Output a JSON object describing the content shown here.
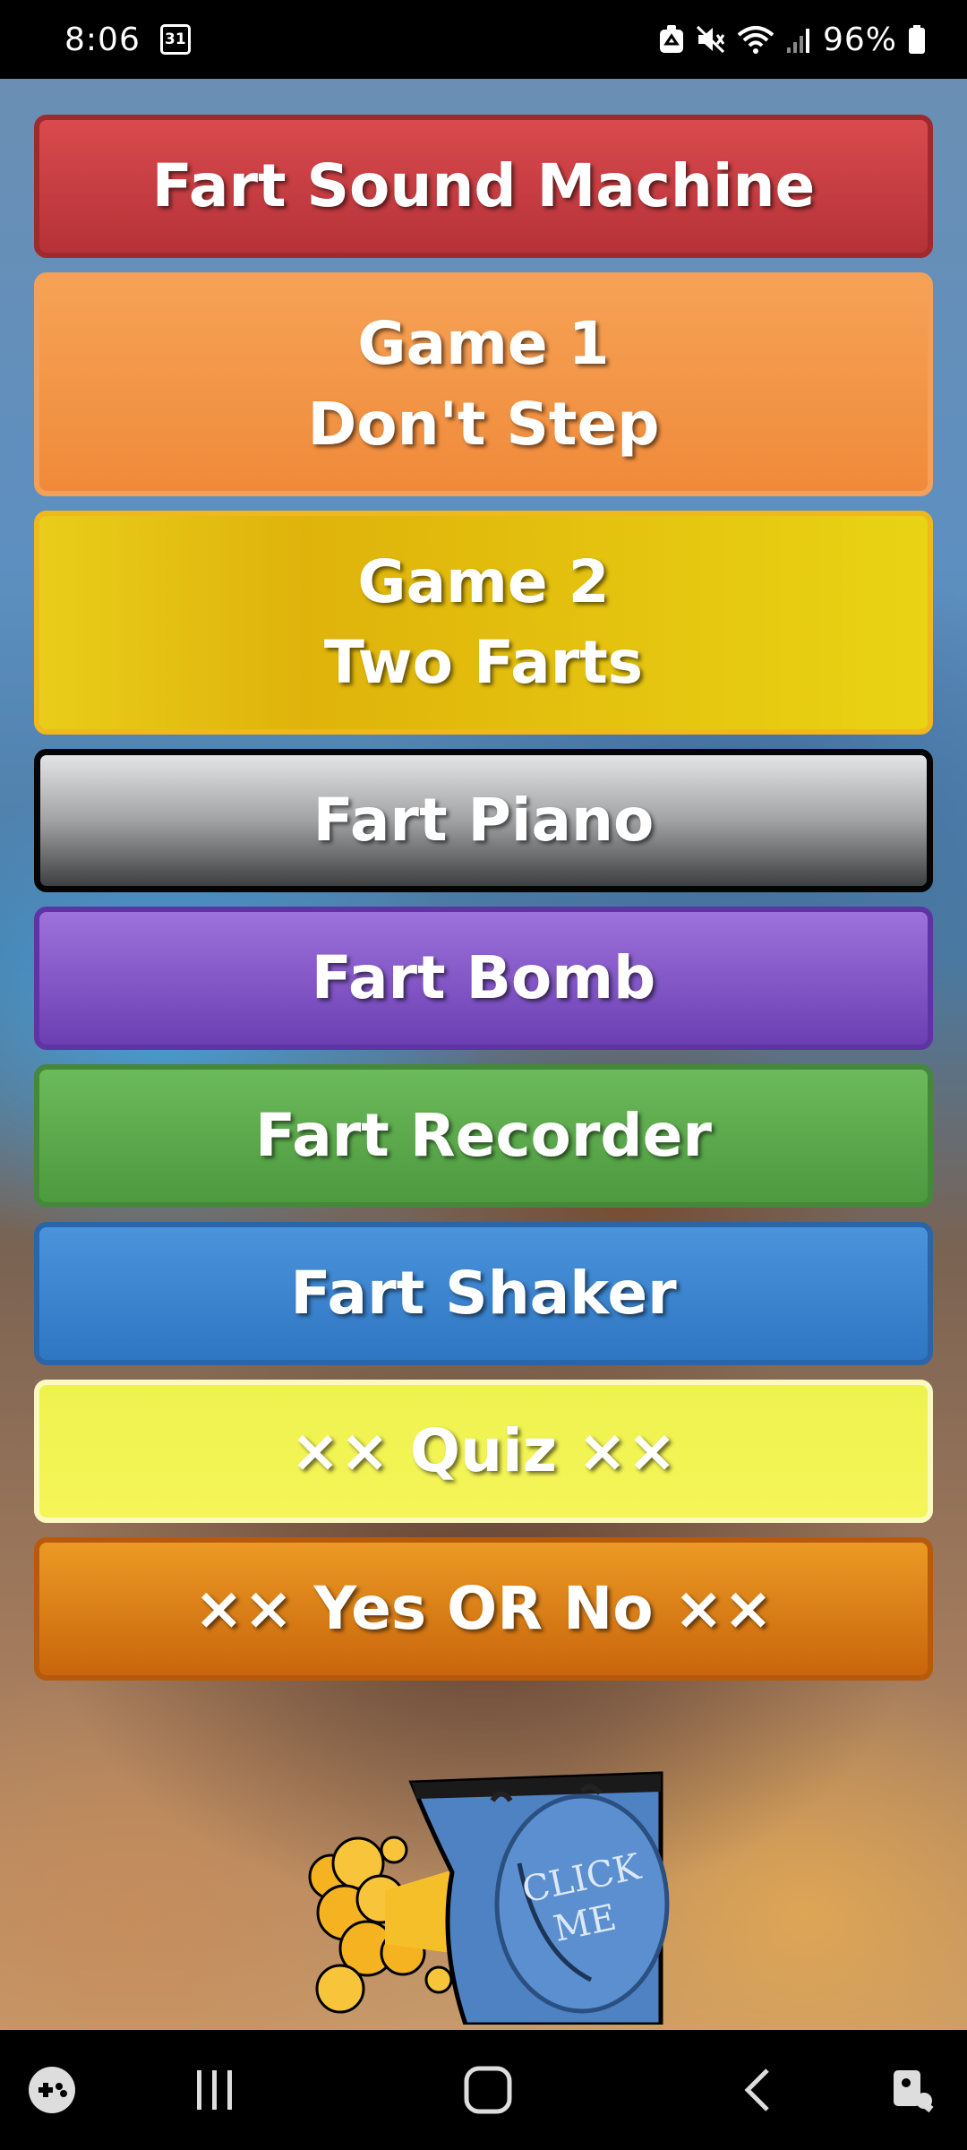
{
  "status_bar": {
    "time": "8:06",
    "calendar_day": "31",
    "battery_percent": "96%"
  },
  "menu": {
    "buttons": [
      {
        "lines": [
          "Fart Sound Machine"
        ],
        "color": "#c23a3f"
      },
      {
        "lines": [
          "Game 1",
          "Don't Step"
        ],
        "color": "#f39446"
      },
      {
        "lines": [
          "Game 2",
          "Two Farts"
        ],
        "color": "#e4c210"
      },
      {
        "lines": [
          "Fart Piano"
        ],
        "color": "#8c8e90"
      },
      {
        "lines": [
          "Fart Bomb"
        ],
        "color": "#7e52c6"
      },
      {
        "lines": [
          "Fart Recorder"
        ],
        "color": "#5aa84a"
      },
      {
        "lines": [
          "Fart Shaker"
        ],
        "color": "#3a85d0"
      },
      {
        "lines": [
          "×× Quiz ××"
        ],
        "color": "#f2f252"
      },
      {
        "lines": [
          "×× Yes OR No ××"
        ],
        "color": "#d87a16"
      }
    ]
  },
  "promo": {
    "text_line1": "CLICK",
    "text_line2": "ME"
  }
}
